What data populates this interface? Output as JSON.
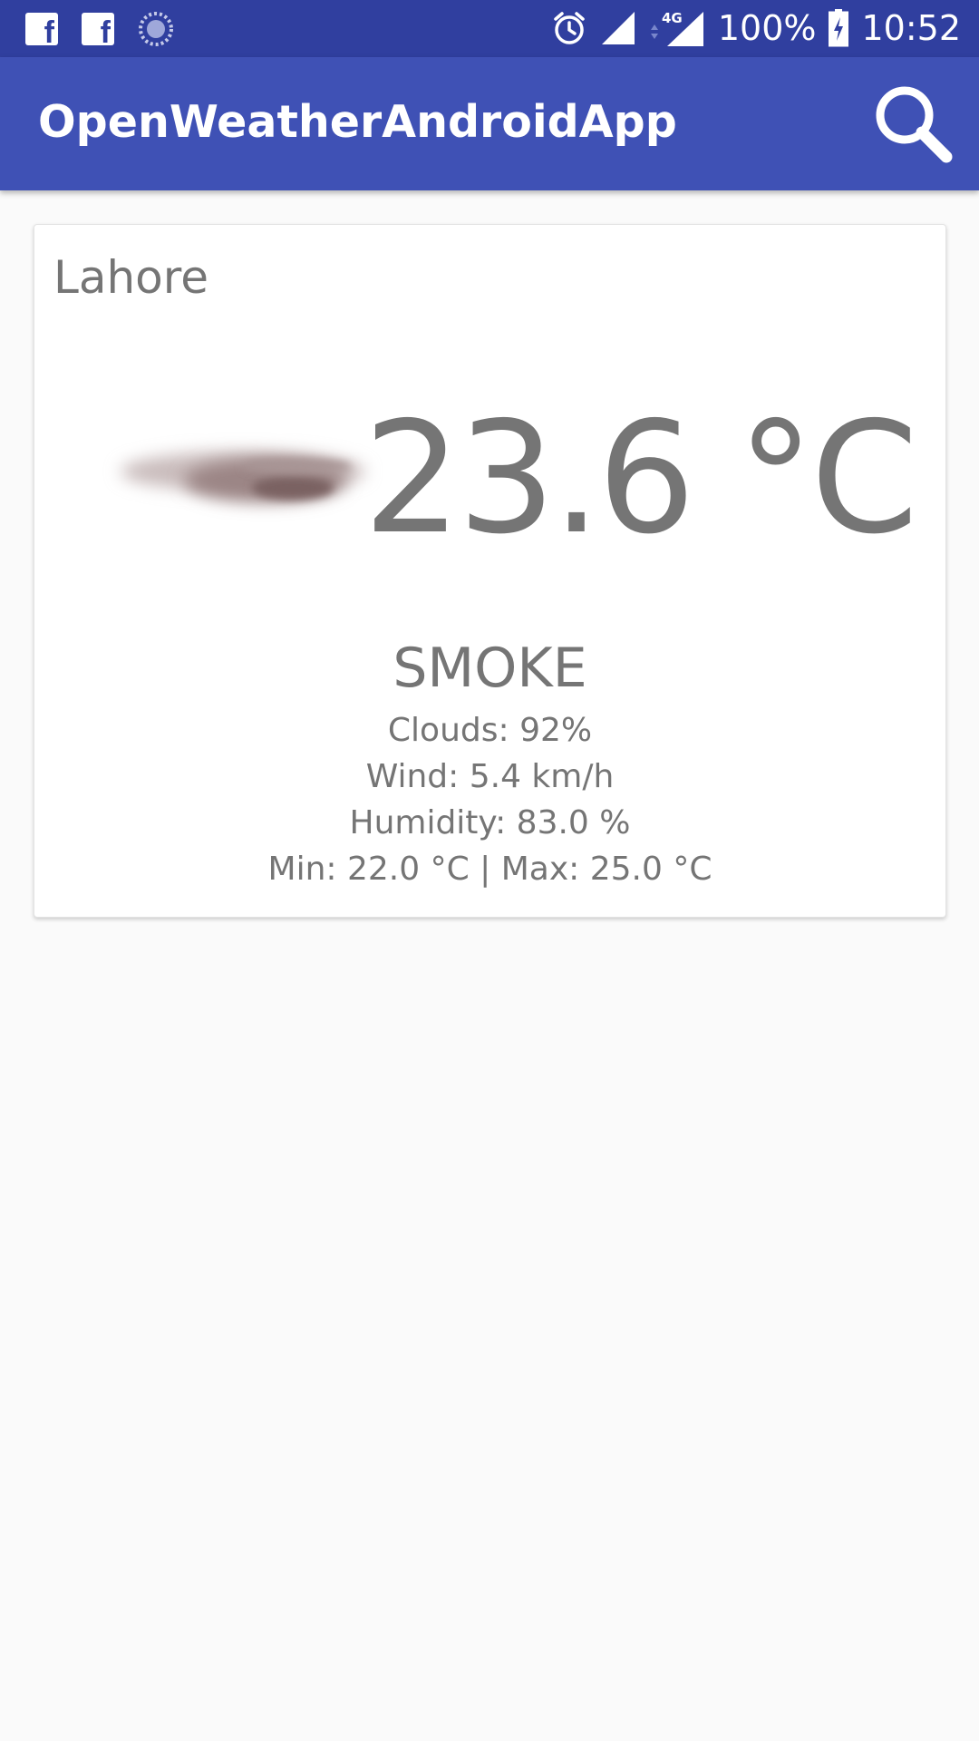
{
  "status_bar": {
    "battery": "100%",
    "time": "10:52",
    "network": "4G",
    "icons": [
      "facebook-icon",
      "facebook-icon",
      "sync-icon",
      "alarm-icon",
      "signal-icon",
      "signal-4g-icon",
      "battery-charging-icon"
    ]
  },
  "app_bar": {
    "title": "OpenWeatherAndroidApp",
    "search_icon": "search-icon"
  },
  "weather": {
    "city": "Lahore",
    "temperature": "23.6 °C",
    "description": "SMOKE",
    "clouds": "Clouds: 92%",
    "wind": "Wind:  5.4 km/h",
    "humidity": "Humidity:  83.0 %",
    "min_max": "Min:  22.0 °C  |  Max:  25.0 °C",
    "icon": "smoke-icon"
  },
  "colors": {
    "status_bar": "#303f9f",
    "app_bar": "#3f51b5",
    "background": "#fafafa",
    "card": "#ffffff",
    "text_secondary": "#757575"
  }
}
